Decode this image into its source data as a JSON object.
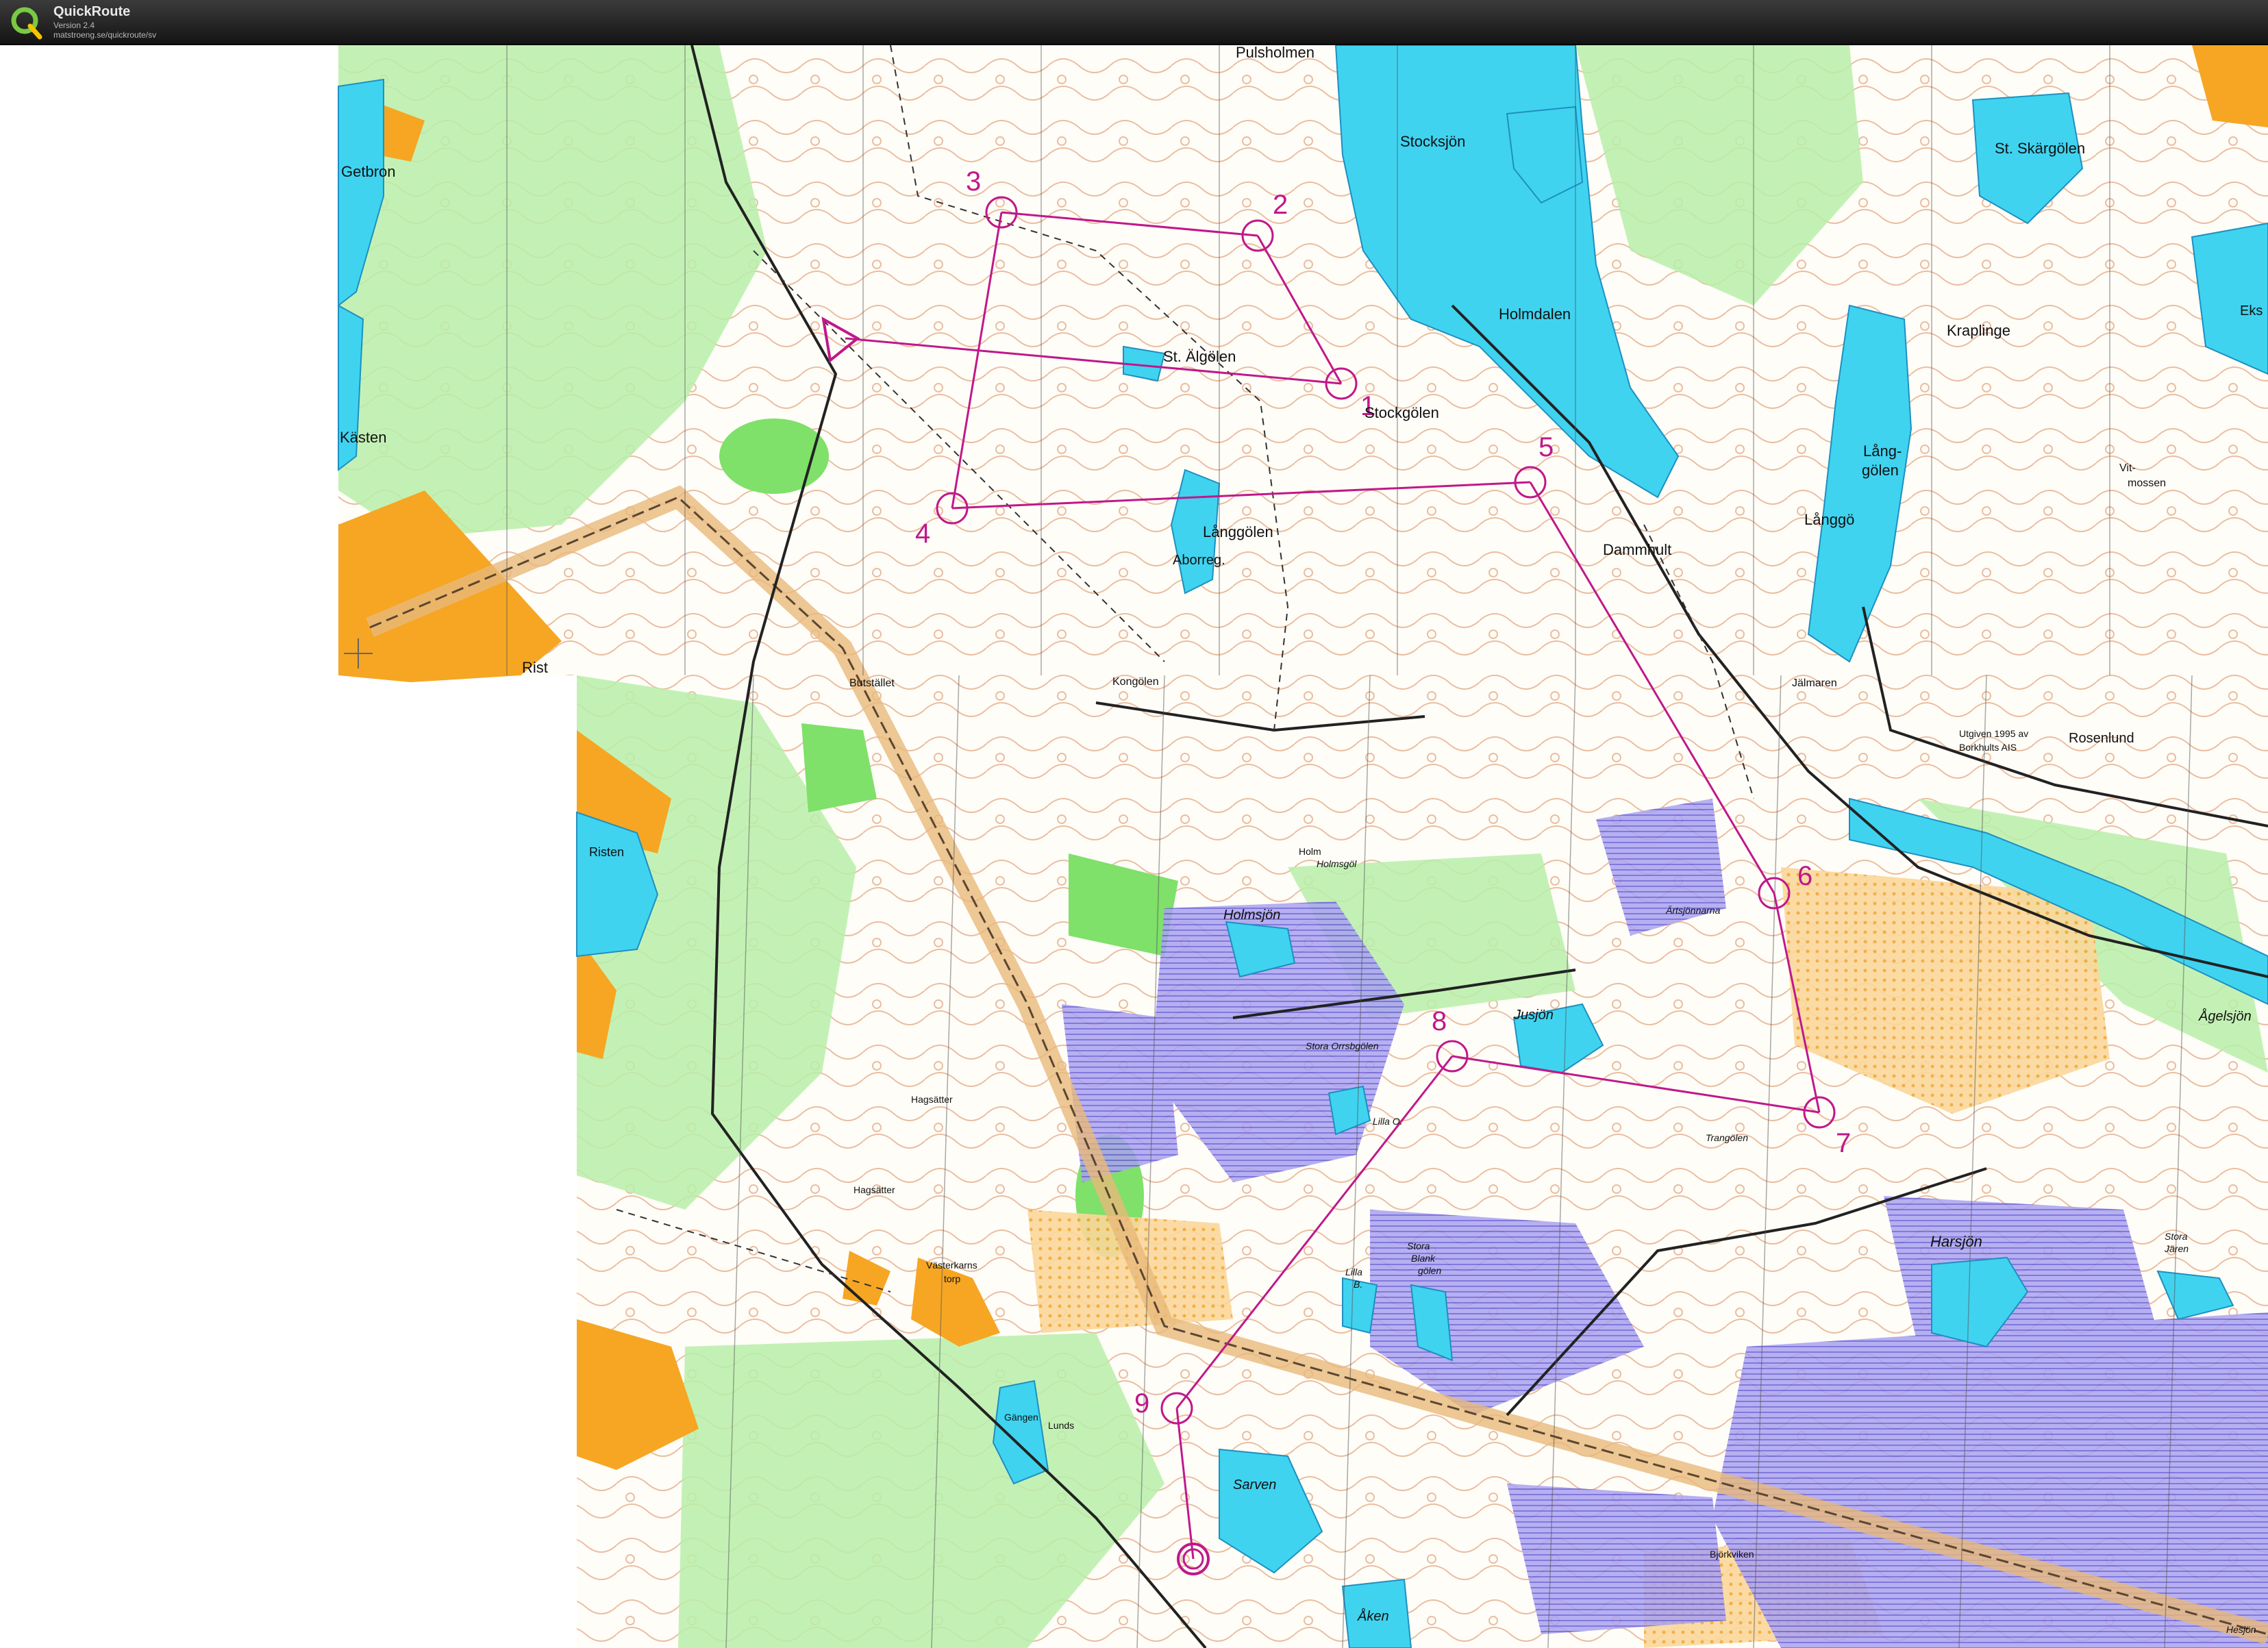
{
  "app": {
    "title": "QuickRoute",
    "version": "Version 2.4",
    "url": "matstroeng.se/quickroute/sv"
  },
  "colors": {
    "titlebar": "#1c1c1c",
    "course": "#c0188a",
    "water": "#3fd3f0",
    "open_land": "#f6a623",
    "marsh": "#8c82e6",
    "green": "#8fe07a"
  },
  "course": {
    "start_label": "start-triangle",
    "controls": [
      {
        "label": "1"
      },
      {
        "label": "2"
      },
      {
        "label": "3"
      },
      {
        "label": "4"
      },
      {
        "label": "5"
      },
      {
        "label": "6"
      },
      {
        "label": "7"
      },
      {
        "label": "8"
      },
      {
        "label": "9"
      }
    ],
    "finish_label": "finish-circle"
  },
  "place_names": [
    "Pulsholmen",
    "Stocksjön",
    "Getbron",
    "Holmdalen",
    "St. Älgölen",
    "Stockgölen",
    "Kraplinge",
    "St. Skärgölen",
    "Kästen",
    "Lång-",
    "gölen",
    "Långgö",
    "Vit-",
    "mossen",
    "Långgölen",
    "Aborreg.",
    "Dammhult",
    "Rist",
    "Butstället",
    "Kongölen",
    "Jälmaren",
    "Rosenlund",
    "Utgiven 1995 av",
    "Borkhults AIS",
    "Ristеn",
    "Holm",
    "Holmsgöl",
    "Holmsjön",
    "Ärtsjönnarna",
    "Jusjön",
    "Stora Orrsbgölen",
    "Lilla O.",
    "Trangölen",
    "Hagsätter",
    "Hagsätter",
    "Västerkarns",
    "torp",
    "Stora",
    "Blank",
    "gölen",
    "Lilla",
    "B.",
    "Harsjön",
    "Stora",
    "Jären",
    "Ågelsjön",
    "Gängen",
    "Sarven",
    "Åken",
    "Björkviken",
    "Hesjön",
    "Lunds",
    "Eks"
  ]
}
